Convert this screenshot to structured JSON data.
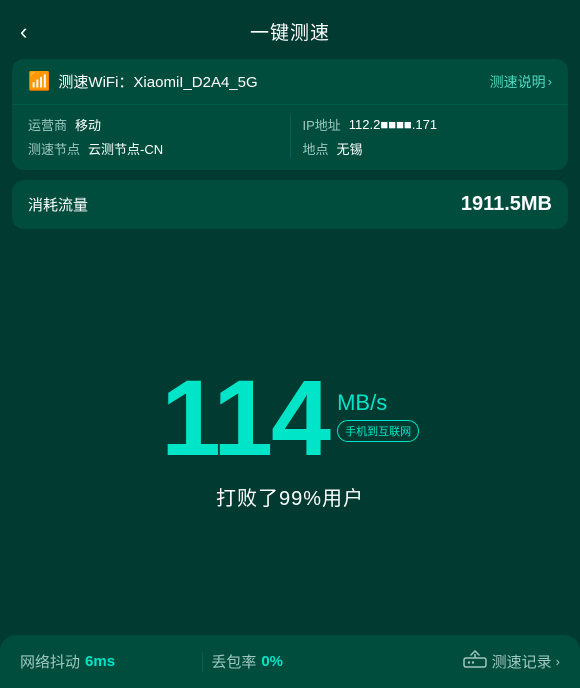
{
  "header": {
    "title": "一键测速",
    "back_label": "‹"
  },
  "wifi": {
    "icon": "📶",
    "prefix": "测速WiFi：",
    "name": "XiaomiI_D2A4_5G",
    "explain_label": "测速说明",
    "explain_arrow": "›"
  },
  "details": {
    "isp_label": "运营商",
    "isp_value": "移动",
    "node_label": "测速节点",
    "node_value": "云测节点-CN",
    "ip_label": "IP地址",
    "ip_value": "112.2■■■■.171",
    "location_label": "地点",
    "location_value": "无锡"
  },
  "traffic": {
    "label": "消耗流量",
    "value": "1911.5MB"
  },
  "speed": {
    "number": "114",
    "unit": "MB/s",
    "badge": "手机到互联网",
    "description": "打败了99%用户"
  },
  "bottom": {
    "jitter_label": "网络抖动",
    "jitter_value": "6ms",
    "loss_label": "丢包率",
    "loss_value": "0%",
    "router_icon": "⊟",
    "record_label": "测速记录",
    "record_arrow": "›"
  }
}
